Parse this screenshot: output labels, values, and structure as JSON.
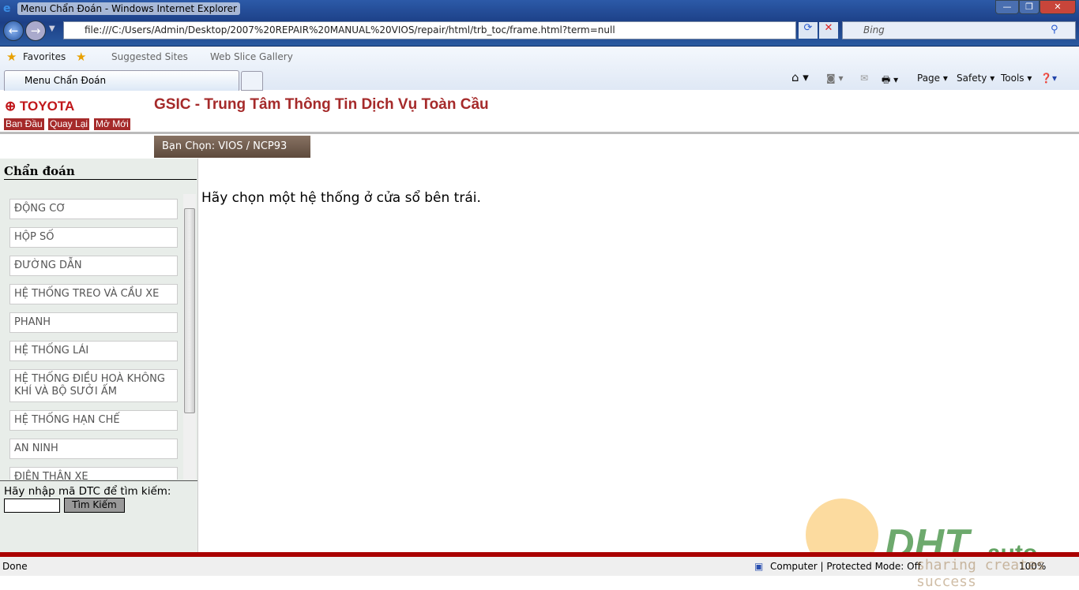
{
  "browser": {
    "window_title": "Menu Chẩn Đoán - Windows Internet Explorer",
    "address": "file:///C:/Users/Admin/Desktop/2007%20REPAIR%20MANUAL%20VIOS/repair/html/trb_toc/frame.html?term=null",
    "search_placeholder": "Bing",
    "favorites": "Favorites",
    "suggested_sites": "Suggested Sites",
    "web_slice_gallery": "Web Slice Gallery",
    "tab_title": "Menu Chẩn Đoán",
    "commands": {
      "page": "Page",
      "safety": "Safety",
      "tools": "Tools"
    },
    "status": {
      "left": "Done",
      "zone": "Computer | Protected Mode: Off",
      "zoom": "100%"
    }
  },
  "header": {
    "logo": "TOYOTA",
    "title": "GSIC - Trung Tâm Thông Tin Dịch Vụ Toàn Cầu",
    "buttons": [
      "Ban Đầu",
      "Quay Lại",
      "Mở Mới"
    ],
    "selection": "Bạn Chọn: VIOS / NCP93"
  },
  "sidebar": {
    "heading": "Chẩn đoán",
    "items": [
      "ĐỘNG CƠ",
      "HỘP SỐ",
      "ĐƯỜNG DẪN",
      "HỆ THỐNG TREO VÀ CẦU XE",
      "PHANH",
      "HỆ THỐNG LÁI",
      "HỆ THỐNG ĐIỀU HOÀ KHÔNG KHÍ VÀ BỘ SƯỞI ẤM",
      "HỆ THỐNG HẠN CHẾ",
      "AN NINH",
      "ĐIỆN THÂN XE"
    ],
    "search_label": "Hãy nhập mã DTC để tìm kiếm:",
    "search_value": "",
    "search_button": "Tìm Kiếm"
  },
  "main": {
    "message": "Hãy chọn một hệ thống ở cửa sổ bên trái."
  },
  "watermark": {
    "brand": "DHT",
    "suffix": "auto",
    "slogan": "sharing creates success"
  },
  "colors": {
    "accent": "#a52a2a",
    "selection_bg": "#6b5748",
    "sidebar_bg": "#e8ede9"
  }
}
